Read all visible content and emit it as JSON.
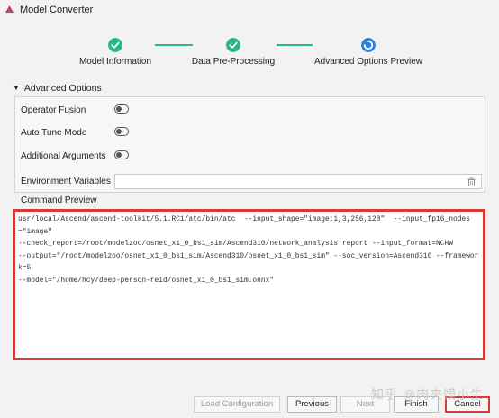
{
  "window": {
    "title": "Model Converter"
  },
  "steps": [
    {
      "label": "Model Information",
      "status": "done"
    },
    {
      "label": "Data Pre-Processing",
      "status": "done"
    },
    {
      "label": "Advanced Options  Preview",
      "status": "active"
    }
  ],
  "advanced": {
    "header": "Advanced Options",
    "options": [
      {
        "label": "Operator Fusion",
        "enabled": false
      },
      {
        "label": "Auto Tune Mode",
        "enabled": false
      },
      {
        "label": "Additional Arguments",
        "enabled": false
      }
    ],
    "env_label": "Environment Variables",
    "env_value": ""
  },
  "preview": {
    "title": "Command Preview",
    "command": "usr/local/Ascend/ascend-toolkit/5.1.RC1/atc/bin/atc  --input_shape=\"image:1,3,256,128\"  --input_fp16_nodes=\"image\"\n--check_report=/root/modelzoo/osnet_x1_0_bs1_sim/Ascend310/network_analysis.report --input_format=NCHW\n--output=\"/root/modelzoo/osnet_x1_0_bs1_sim/Ascend310/osnet_x1_0_bs1_sim\" --soc_version=Ascend310 --framework=5\n--model=\"/home/hcy/deep-person-reid/osnet_x1_0_bs1_sim.onnx\""
  },
  "buttons": {
    "load_config": "Load Configuration",
    "previous": "Previous",
    "next": "Next",
    "finish": "Finish",
    "cancel": "Cancel"
  },
  "watermark": "知乎 @肉夹馍小生",
  "colors": {
    "step_done": "#2bb686",
    "step_active": "#2f7fd8",
    "highlight": "#d83a3a"
  }
}
